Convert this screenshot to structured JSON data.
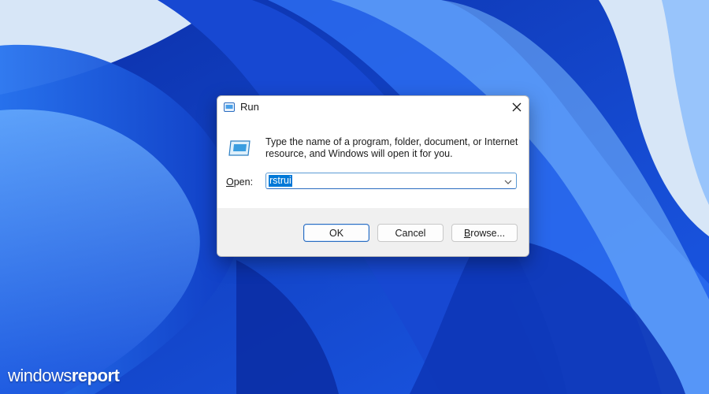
{
  "dialog": {
    "title": "Run",
    "description": "Type the name of a program, folder, document, or Internet resource, and Windows will open it for you.",
    "open_label_accel": "O",
    "open_label_rest": "pen:",
    "input_value": "rstrui",
    "buttons": {
      "ok": "OK",
      "cancel": "Cancel",
      "browse_accel": "B",
      "browse_rest": "rowse..."
    },
    "icons": {
      "title": "run-icon",
      "content": "run-program-icon",
      "close": "close-icon",
      "dropdown": "chevron-down-icon"
    }
  },
  "watermark": {
    "part1": "windows",
    "part2": "report"
  },
  "colors": {
    "selection": "#0078d7",
    "focus_border": "#2a6cc0",
    "footer": "#f0f0f0",
    "wallpaper_base": "#1f4fd6"
  }
}
